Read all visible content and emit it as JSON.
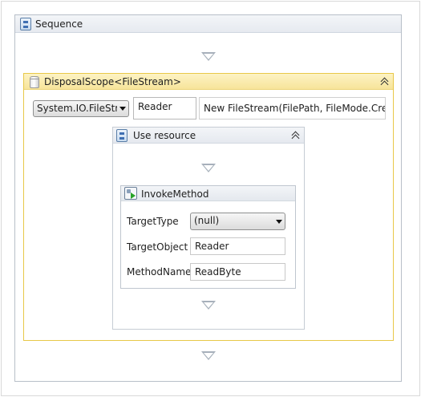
{
  "sequence": {
    "title": "Sequence",
    "icon": "sequence-icon"
  },
  "disposal_scope": {
    "title": "DisposalScope<FileStream>",
    "icon": "disposal-scope-icon",
    "type_selector": {
      "value": "System.IO.FileStre"
    },
    "variable_name": "Reader",
    "initializer": "New FileStream(FilePath, FileMode.Create)"
  },
  "use_resource": {
    "title": "Use resource",
    "icon": "sequence-icon"
  },
  "invoke_method": {
    "title": "InvokeMethod",
    "icon": "invoke-method-icon",
    "properties": {
      "target_type": {
        "label": "TargetType",
        "value": "(null)"
      },
      "target_object": {
        "label": "TargetObject",
        "value": "Reader"
      },
      "method_name": {
        "label": "MethodName",
        "value": "ReadByte"
      }
    }
  },
  "colors": {
    "selected_border": "#e8c848",
    "selected_header": "#f7e49a",
    "activity_border": "#b8bfc8",
    "drop_arrow": "#a7b0bb"
  }
}
